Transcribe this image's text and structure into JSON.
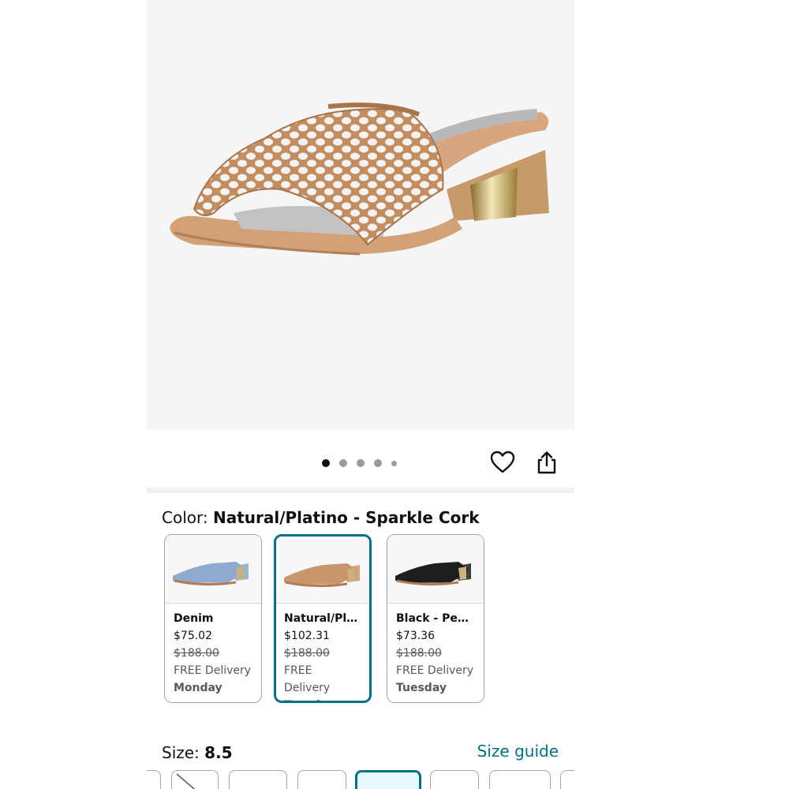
{
  "hero": {
    "image_alt": "Woven natural cork slide sandal with gold block heel",
    "dots": 5,
    "active_dot": 0
  },
  "color": {
    "label": "Color: ",
    "value": "Natural/Platino - Sparkle Cork"
  },
  "swatches": [
    {
      "name": "Denim",
      "price": "$75.02",
      "list_price": "$188.00",
      "delivery": "FREE Delivery",
      "day": "Monday",
      "selected": false,
      "shoe_color": "#8fa9cf"
    },
    {
      "name": "Natural/Plati...",
      "price": "$102.31",
      "list_price": "$188.00",
      "delivery": "FREE Delivery",
      "day": "Tuesday",
      "selected": true,
      "shoe_color": "#c9956b"
    },
    {
      "name": "Black - Pebbl...",
      "price": "$73.36",
      "list_price": "$188.00",
      "delivery": "FREE Delivery",
      "day": "Tuesday",
      "selected": false,
      "shoe_color": "#1e1e1e"
    }
  ],
  "size": {
    "label": "Size: ",
    "value": "8.5",
    "guide": "Size guide"
  },
  "colors": {
    "accent": "#007185",
    "selected_fill": "#e6f9fc",
    "cork": "#c9956b"
  }
}
